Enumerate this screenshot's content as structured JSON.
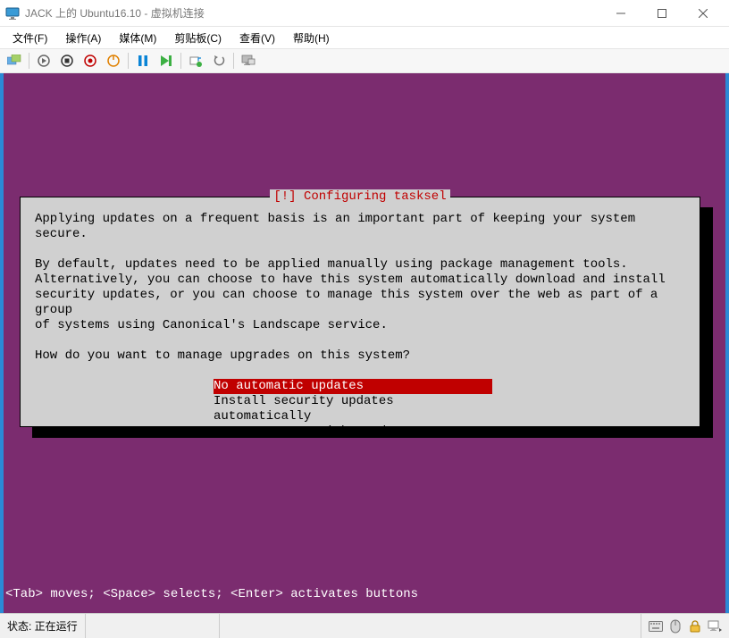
{
  "window": {
    "title": "JACK 上的 Ubuntu16.10 - 虚拟机连接"
  },
  "menu": {
    "file": "文件(F)",
    "action": "操作(A)",
    "media": "媒体(M)",
    "clipboard": "剪贴板(C)",
    "view": "查看(V)",
    "help": "帮助(H)"
  },
  "dialog": {
    "title": "[!] Configuring tasksel",
    "para1": "Applying updates on a frequent basis is an important part of keeping your system secure.",
    "para2": "By default, updates need to be applied manually using package management tools.\nAlternatively, you can choose to have this system automatically download and install\nsecurity updates, or you can choose to manage this system over the web as part of a group\nof systems using Canonical's Landscape service.",
    "question": "How do you want to manage upgrades on this system?",
    "options": [
      {
        "label": "No automatic updates",
        "selected": true
      },
      {
        "label": "Install security updates automatically",
        "selected": false
      },
      {
        "label": "Manage system with Landscape",
        "selected": false
      }
    ]
  },
  "hint": "<Tab> moves; <Space> selects; <Enter> activates buttons",
  "status": {
    "label": "状态: 正在运行"
  }
}
